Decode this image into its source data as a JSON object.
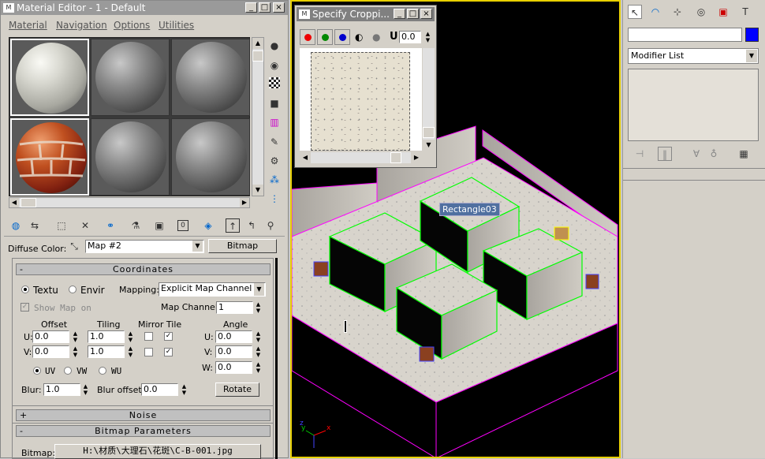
{
  "material_editor": {
    "title": "Material Editor - 1 - Default",
    "menu": [
      "Material",
      "Navigation",
      "Options",
      "Utilities"
    ],
    "diffuse_label": "Diffuse Color:",
    "map_name": "Map #2",
    "map_type": "Bitmap",
    "coordinates": {
      "header": "Coordinates",
      "texture_radio": "Textu",
      "environ_radio": "Envir",
      "mapping_label": "Mapping:",
      "mapping_value": "Explicit Map Channel",
      "show_map_on": "Show Map on",
      "map_channel_label": "Map Channel:",
      "map_channel_value": "1",
      "col_offset": "Offset",
      "col_tiling": "Tiling",
      "col_mirror_tile": "Mirror Tile",
      "col_angle": "Angle",
      "u_label": "U:",
      "v_label": "V:",
      "w_label": "W:",
      "u_offset": "0.0",
      "v_offset": "0.0",
      "u_tiling": "1.0",
      "v_tiling": "1.0",
      "u_angle": "0.0",
      "v_angle": "0.0",
      "w_angle": "0.0",
      "uv": "UV",
      "vw": "VW",
      "wu": "WU",
      "blur_label": "Blur:",
      "blur_value": "1.0",
      "blur_offset_label": "Blur offset:",
      "blur_offset_value": "0.0",
      "rotate_label": "Rotate"
    },
    "noise_header": "Noise",
    "bitmap_params_header": "Bitmap Parameters",
    "bitmap_label": "Bitmap:",
    "bitmap_path": "H:\\材质\\大理石\\花斑\\C-B-001.jpg"
  },
  "crop_dialog": {
    "title": "Specify Croppi...",
    "u_label": "U",
    "u_value": "0.0"
  },
  "viewport": {
    "object_label": "Rectangle03",
    "axis_x": "x",
    "axis_y": "y",
    "axis_z": "z"
  },
  "command_panel": {
    "modifier_list": "Modifier List",
    "accent_color": "#0000ff"
  }
}
